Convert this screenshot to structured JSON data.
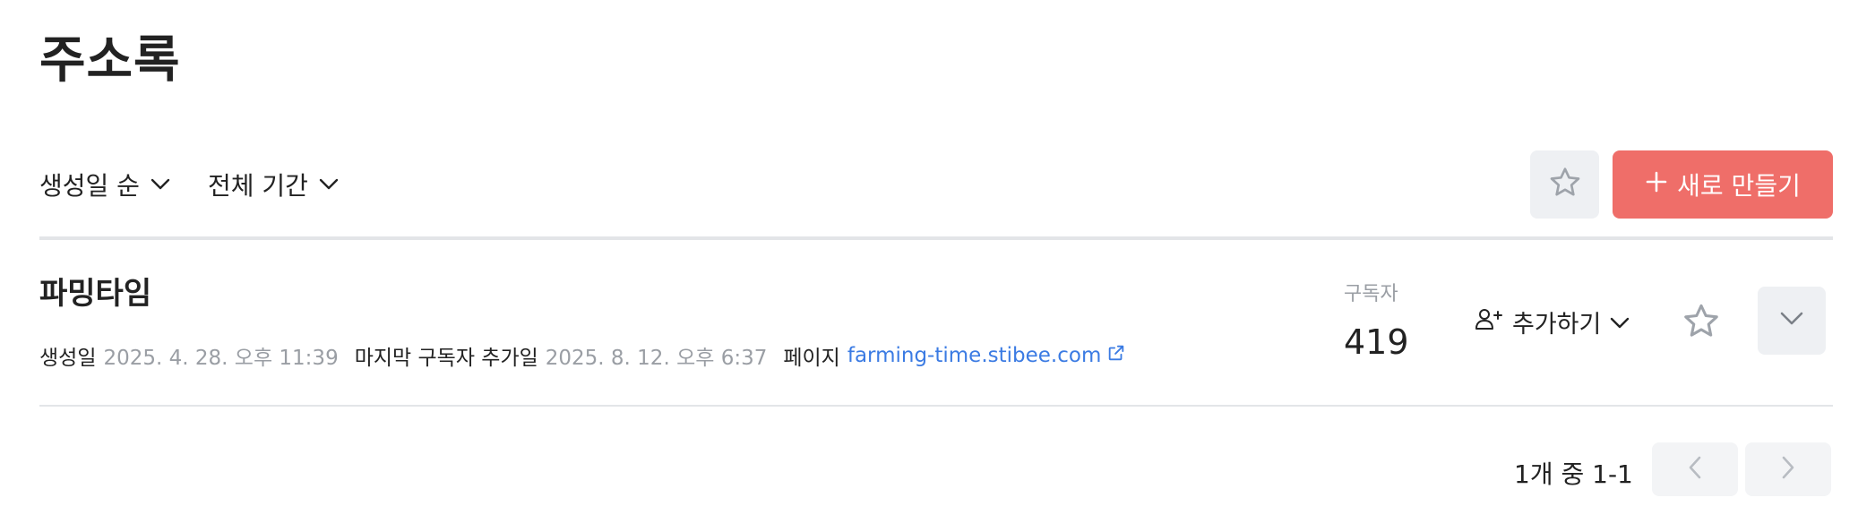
{
  "page": {
    "title": "주소록"
  },
  "toolbar": {
    "sort_label": "생성일 순",
    "period_label": "전체 기간",
    "create_label": "새로 만들기",
    "create_color": "#ef6e69"
  },
  "list": [
    {
      "name": "파밍타임",
      "created_label": "생성일",
      "created_value": "2025. 4. 28. 오후 11:39",
      "last_sub_label": "마지막 구독자 추가일",
      "last_sub_value": "2025. 8. 12. 오후 6:37",
      "page_label": "페이지",
      "page_link": "farming-time.stibee.com",
      "subscribers_label": "구독자",
      "subscribers_count": "419",
      "add_label": "추가하기"
    }
  ],
  "pagination": {
    "summary": "1개 중 1-1"
  },
  "icons": {
    "sort": "chevron-down-icon",
    "favorite": "star-icon",
    "create": "plus-icon",
    "link": "external-link-icon",
    "add": "person-add-icon",
    "expand": "chevron-down-icon",
    "prev": "chevron-left-icon",
    "next": "chevron-right-icon"
  }
}
